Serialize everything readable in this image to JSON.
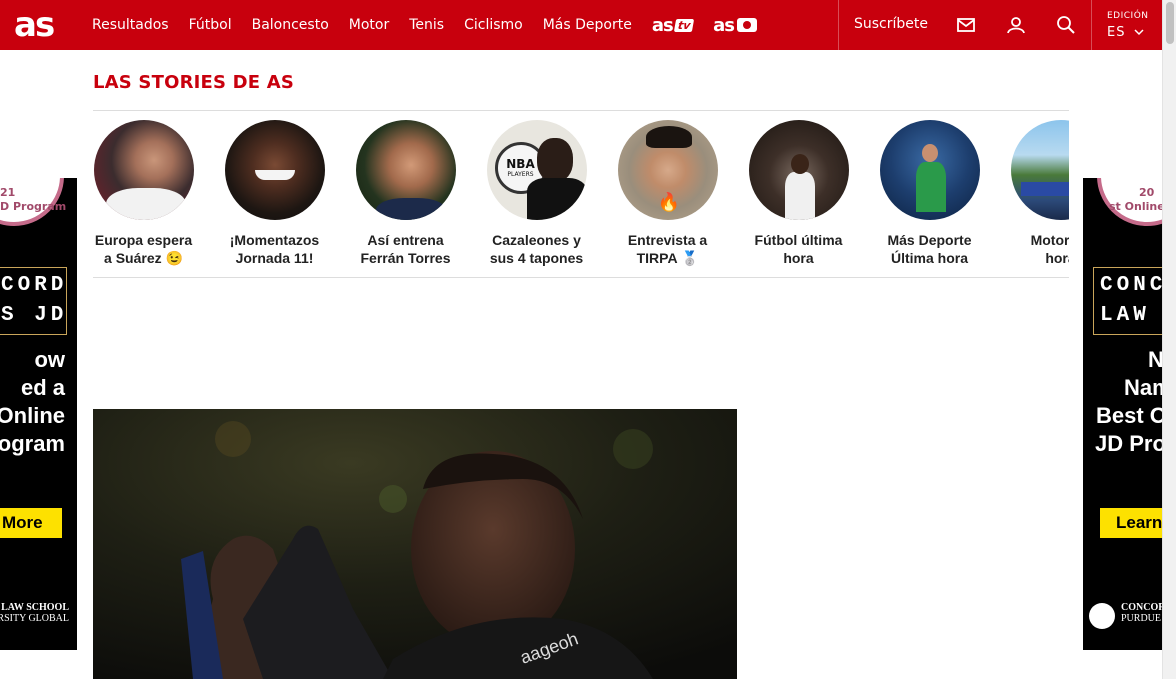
{
  "header": {
    "logo": "as",
    "nav": [
      "Resultados",
      "Fútbol",
      "Baloncesto",
      "Motor",
      "Tenis",
      "Ciclismo",
      "Más Deporte"
    ],
    "brand_tv_main": "as",
    "brand_tv_tag": "tv",
    "brand_photo_main": "as",
    "subscribe": "Suscríbete",
    "edition_label": "EDICIÓN",
    "edition_value": "ES"
  },
  "stories": {
    "title": "LAS STORIES DE AS",
    "items": [
      {
        "line1": "Europa espera",
        "line2": "a Suárez 😉"
      },
      {
        "line1": "¡Momentazos",
        "line2": "Jornada 11!"
      },
      {
        "line1": "Así entrena",
        "line2": "Ferrán Torres"
      },
      {
        "line1": "Cazaleones y",
        "line2": "sus 4 tapones"
      },
      {
        "line1": "Entrevista a",
        "line2": "TIRPA 🥈"
      },
      {
        "line1": "Fútbol última",
        "line2": "hora"
      },
      {
        "line1": "Más Deporte",
        "line2": "Última hora"
      },
      {
        "line1": "Motor últ",
        "line2": "hora"
      }
    ],
    "nba_badge": "NBA",
    "nba_badge_sub": "PLAYERS"
  },
  "ad_left": {
    "seal_text": "21",
    "seal_text2": "D Program",
    "name_line1": "CORD",
    "name_line2": "S JD",
    "headline": [
      "ow",
      "ed a",
      "Online",
      "ogram"
    ],
    "cta": "More",
    "footer_line1": "O LAW SCHOOL",
    "footer_line2": "IVERSITY GLOBAL"
  },
  "ad_right": {
    "seal_text": "20",
    "seal_text2": "st Online J",
    "name_line1": "CONC",
    "name_line2": "LAW",
    "headline": [
      "No",
      "Nam",
      "Best O",
      "JD Pro"
    ],
    "cta": "Learn",
    "footer_line1": "CONCOR",
    "footer_line2": "PURDUE U"
  },
  "colors": {
    "brand_red": "#c8000d",
    "ad_yellow": "#fde100",
    "ad_gold": "#c9a55a"
  }
}
